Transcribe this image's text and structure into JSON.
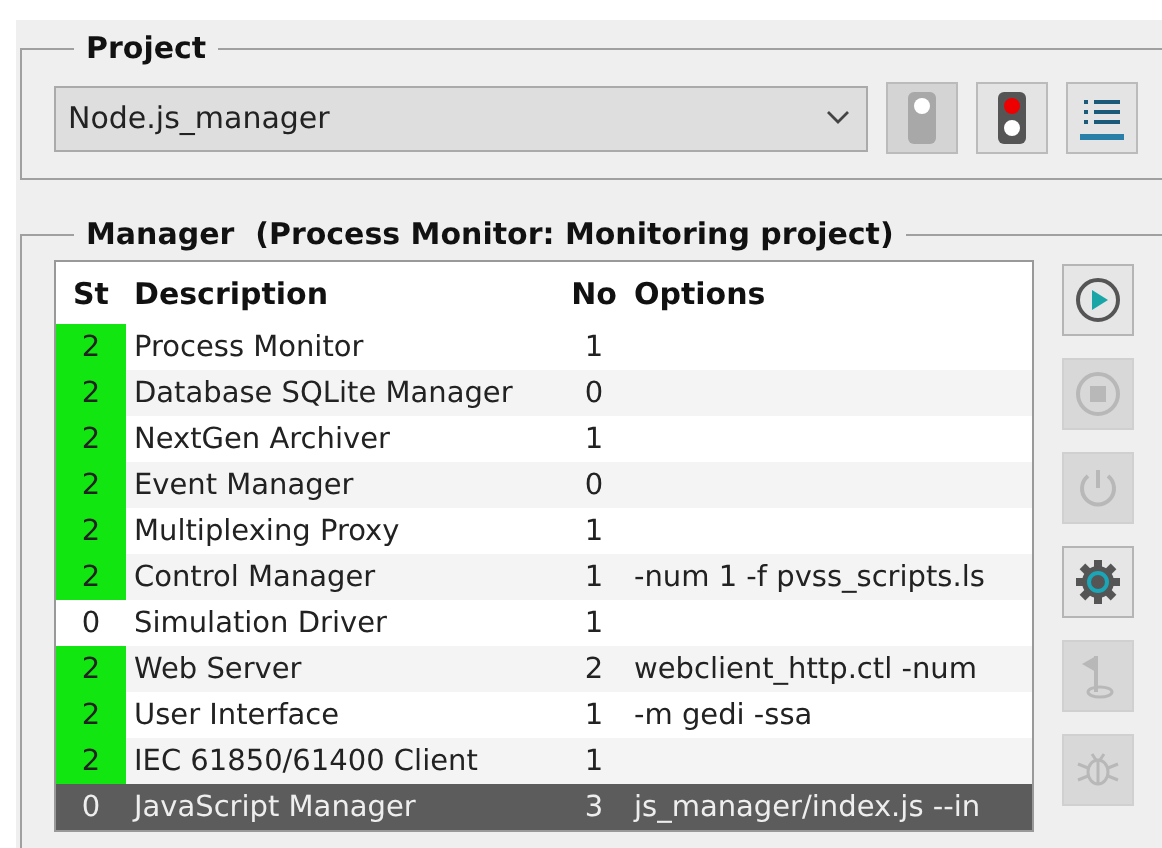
{
  "project": {
    "title": "Project",
    "selector": {
      "value": "Node.js_manager"
    },
    "buttons": [
      {
        "kind": "idle-light",
        "disabled": true
      },
      {
        "kind": "stop-light",
        "disabled": false
      },
      {
        "kind": "list",
        "disabled": false
      }
    ]
  },
  "manager": {
    "title": "Manager  (Process Monitor: Monitoring project)",
    "table": {
      "columns": [
        "St",
        "Description",
        "No",
        "Options"
      ],
      "rows": [
        {
          "st": "2",
          "running": true,
          "description": "Process Monitor",
          "no": "1",
          "options": "",
          "selected": false
        },
        {
          "st": "2",
          "running": true,
          "description": "Database SQLite Manager",
          "no": "0",
          "options": "",
          "selected": false
        },
        {
          "st": "2",
          "running": true,
          "description": "NextGen Archiver",
          "no": "1",
          "options": "",
          "selected": false
        },
        {
          "st": "2",
          "running": true,
          "description": "Event Manager",
          "no": "0",
          "options": "",
          "selected": false
        },
        {
          "st": "2",
          "running": true,
          "description": "Multiplexing Proxy",
          "no": "1",
          "options": "",
          "selected": false
        },
        {
          "st": "2",
          "running": true,
          "description": "Control Manager",
          "no": "1",
          "options": "-num 1 -f pvss_scripts.ls",
          "selected": false
        },
        {
          "st": "0",
          "running": false,
          "description": "Simulation Driver",
          "no": "1",
          "options": "",
          "selected": false
        },
        {
          "st": "2",
          "running": true,
          "description": "Web Server",
          "no": "2",
          "options": "webclient_http.ctl -num",
          "selected": false
        },
        {
          "st": "2",
          "running": true,
          "description": "User Interface",
          "no": "1",
          "options": "-m gedi -ssa",
          "selected": false
        },
        {
          "st": "2",
          "running": true,
          "description": "IEC 61850/61400 Client",
          "no": "1",
          "options": "",
          "selected": false
        },
        {
          "st": "0",
          "running": false,
          "description": "JavaScript Manager",
          "no": "3",
          "options": "js_manager/index.js --in",
          "selected": true
        }
      ]
    },
    "actions": [
      {
        "kind": "start",
        "disabled": false
      },
      {
        "kind": "stop",
        "disabled": true
      },
      {
        "kind": "power",
        "disabled": true
      },
      {
        "kind": "settings",
        "disabled": false
      },
      {
        "kind": "flag",
        "disabled": true
      },
      {
        "kind": "debug",
        "disabled": true
      }
    ]
  }
}
